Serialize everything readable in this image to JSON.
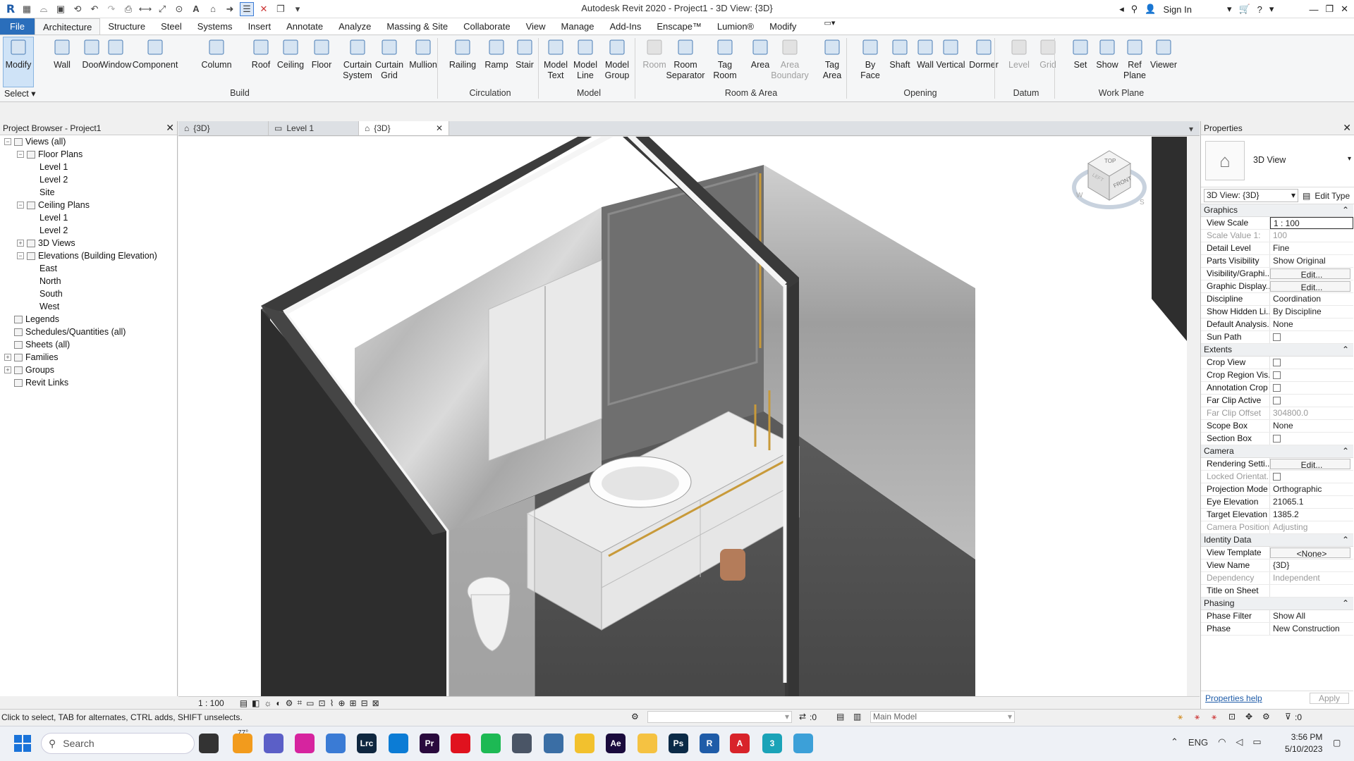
{
  "window": {
    "title": "Autodesk Revit 2020 - Project1 - 3D View: {3D}",
    "sign_in": "Sign In"
  },
  "ribbon_tabs": [
    "File",
    "Architecture",
    "Structure",
    "Steel",
    "Systems",
    "Insert",
    "Annotate",
    "Analyze",
    "Massing & Site",
    "Collaborate",
    "View",
    "Manage",
    "Add-Ins",
    "Enscape™",
    "Lumion®",
    "Modify"
  ],
  "active_tab": "Architecture",
  "ribbon": {
    "select_label": "Select",
    "buttons": [
      {
        "label": "Modify",
        "icon": "cursor-icon"
      },
      {
        "label": "Wall",
        "icon": "wall-icon"
      },
      {
        "label": "Door",
        "icon": "door-icon"
      },
      {
        "label": "Window",
        "icon": "window-icon"
      },
      {
        "label": "Component",
        "icon": "component-icon"
      },
      {
        "label": "Column",
        "icon": "column-icon"
      },
      {
        "label": "Roof",
        "icon": "roof-icon"
      },
      {
        "label": "Ceiling",
        "icon": "ceiling-icon"
      },
      {
        "label": "Floor",
        "icon": "floor-icon"
      },
      {
        "label": "Curtain\nSystem",
        "icon": "curtain-system-icon"
      },
      {
        "label": "Curtain\nGrid",
        "icon": "curtain-grid-icon"
      },
      {
        "label": "Mullion",
        "icon": "mullion-icon"
      },
      {
        "label": "Railing",
        "icon": "railing-icon"
      },
      {
        "label": "Ramp",
        "icon": "ramp-icon"
      },
      {
        "label": "Stair",
        "icon": "stair-icon"
      },
      {
        "label": "Model\nText",
        "icon": "model-text-icon"
      },
      {
        "label": "Model\nLine",
        "icon": "model-line-icon"
      },
      {
        "label": "Model\nGroup",
        "icon": "model-group-icon"
      },
      {
        "label": "Room",
        "icon": "room-icon"
      },
      {
        "label": "Room\nSeparator",
        "icon": "room-separator-icon"
      },
      {
        "label": "Tag\nRoom",
        "icon": "tag-room-icon"
      },
      {
        "label": "Area",
        "icon": "area-icon"
      },
      {
        "label": "Area\nBoundary",
        "icon": "area-boundary-icon"
      },
      {
        "label": "Tag\nArea",
        "icon": "tag-area-icon"
      },
      {
        "label": "By\nFace",
        "icon": "by-face-icon"
      },
      {
        "label": "Shaft",
        "icon": "shaft-icon"
      },
      {
        "label": "Wall",
        "icon": "wall-opening-icon"
      },
      {
        "label": "Vertical",
        "icon": "vertical-icon"
      },
      {
        "label": "Dormer",
        "icon": "dormer-icon"
      },
      {
        "label": "Level",
        "icon": "level-icon"
      },
      {
        "label": "Grid",
        "icon": "grid-icon"
      },
      {
        "label": "Set",
        "icon": "set-icon"
      },
      {
        "label": "Show",
        "icon": "show-icon"
      },
      {
        "label": "Ref\nPlane",
        "icon": "ref-plane-icon"
      },
      {
        "label": "Viewer",
        "icon": "viewer-icon"
      }
    ],
    "panels": [
      "Build",
      "Circulation",
      "Model",
      "Room & Area",
      "Opening",
      "Datum",
      "Work Plane"
    ]
  },
  "project_browser": {
    "title": "Project Browser - Project1",
    "tree": [
      {
        "label": "Views (all)",
        "depth": 0,
        "toggle": "−"
      },
      {
        "label": "Floor Plans",
        "depth": 1,
        "toggle": "−"
      },
      {
        "label": "Level 1",
        "depth": 2
      },
      {
        "label": "Level 2",
        "depth": 2
      },
      {
        "label": "Site",
        "depth": 2
      },
      {
        "label": "Ceiling Plans",
        "depth": 1,
        "toggle": "−"
      },
      {
        "label": "Level 1",
        "depth": 2
      },
      {
        "label": "Level 2",
        "depth": 2
      },
      {
        "label": "3D Views",
        "depth": 1,
        "toggle": "+"
      },
      {
        "label": "Elevations (Building Elevation)",
        "depth": 1,
        "toggle": "−"
      },
      {
        "label": "East",
        "depth": 2
      },
      {
        "label": "North",
        "depth": 2
      },
      {
        "label": "South",
        "depth": 2
      },
      {
        "label": "West",
        "depth": 2
      },
      {
        "label": "Legends",
        "depth": 0
      },
      {
        "label": "Schedules/Quantities (all)",
        "depth": 0
      },
      {
        "label": "Sheets (all)",
        "depth": 0
      },
      {
        "label": "Families",
        "depth": 0,
        "toggle": "+"
      },
      {
        "label": "Groups",
        "depth": 0,
        "toggle": "+"
      },
      {
        "label": "Revit Links",
        "depth": 0
      }
    ]
  },
  "view_tabs": [
    {
      "label": "{3D}",
      "active": false
    },
    {
      "label": "Level 1",
      "active": false
    },
    {
      "label": "{3D}",
      "active": true
    }
  ],
  "viewcube": {
    "top": "TOP",
    "front": "FRONT",
    "left": "LEFT",
    "west": "W",
    "south": "S"
  },
  "view_control_bar": {
    "scale": "1 : 100"
  },
  "properties": {
    "title": "Properties",
    "type_name": "3D View",
    "selector": "3D View: {3D}",
    "edit_type": "Edit Type",
    "sections": [
      {
        "name": "Graphics",
        "rows": [
          {
            "k": "View Scale",
            "v": "1 : 100",
            "kind": "input"
          },
          {
            "k": "Scale Value    1:",
            "v": "100",
            "ro": true
          },
          {
            "k": "Detail Level",
            "v": "Fine"
          },
          {
            "k": "Parts Visibility",
            "v": "Show Original"
          },
          {
            "k": "Visibility/Graphi...",
            "v": "Edit...",
            "kind": "button"
          },
          {
            "k": "Graphic Display...",
            "v": "Edit...",
            "kind": "button"
          },
          {
            "k": "Discipline",
            "v": "Coordination"
          },
          {
            "k": "Show Hidden Li...",
            "v": "By Discipline"
          },
          {
            "k": "Default Analysis...",
            "v": "None"
          },
          {
            "k": "Sun Path",
            "v": "",
            "kind": "checkbox"
          }
        ]
      },
      {
        "name": "Extents",
        "rows": [
          {
            "k": "Crop View",
            "v": "",
            "kind": "checkbox"
          },
          {
            "k": "Crop Region Vis...",
            "v": "",
            "kind": "checkbox"
          },
          {
            "k": "Annotation Crop",
            "v": "",
            "kind": "checkbox"
          },
          {
            "k": "Far Clip Active",
            "v": "",
            "kind": "checkbox"
          },
          {
            "k": "Far Clip Offset",
            "v": "304800.0",
            "ro": true
          },
          {
            "k": "Scope Box",
            "v": "None"
          },
          {
            "k": "Section Box",
            "v": "",
            "kind": "checkbox"
          }
        ]
      },
      {
        "name": "Camera",
        "rows": [
          {
            "k": "Rendering Setti...",
            "v": "Edit...",
            "kind": "button"
          },
          {
            "k": "Locked Orientat...",
            "v": "",
            "kind": "checkbox",
            "ro": true
          },
          {
            "k": "Projection Mode",
            "v": "Orthographic"
          },
          {
            "k": "Eye Elevation",
            "v": "21065.1"
          },
          {
            "k": "Target Elevation",
            "v": "1385.2"
          },
          {
            "k": "Camera Position",
            "v": "Adjusting",
            "ro": true
          }
        ]
      },
      {
        "name": "Identity Data",
        "rows": [
          {
            "k": "View Template",
            "v": "<None>",
            "kind": "button"
          },
          {
            "k": "View Name",
            "v": "{3D}"
          },
          {
            "k": "Dependency",
            "v": "Independent",
            "ro": true
          },
          {
            "k": "Title on Sheet",
            "v": ""
          }
        ]
      },
      {
        "name": "Phasing",
        "rows": [
          {
            "k": "Phase Filter",
            "v": "Show All"
          },
          {
            "k": "Phase",
            "v": "New Construction"
          }
        ]
      }
    ],
    "help_link": "Properties help",
    "apply": "Apply"
  },
  "status": {
    "message": "Click to select, TAB for alternates, CTRL adds, SHIFT unselects.",
    "count": ":0",
    "model": "Main Model",
    "filter_count": ":0"
  },
  "taskbar": {
    "search": "Search",
    "weather": "77°",
    "lang": "ENG",
    "time": "3:56 PM",
    "date": "5/10/2023",
    "apps": [
      {
        "name": "task-view-icon",
        "label": "",
        "color": "#333333"
      },
      {
        "name": "weather-icon",
        "label": "",
        "color": "#f29b1d"
      },
      {
        "name": "teams-icon",
        "label": "",
        "color": "#5b5fc7"
      },
      {
        "name": "instagram-icon",
        "label": "",
        "color": "#d6249f"
      },
      {
        "name": "sketch-icon",
        "label": "",
        "color": "#3a7bd5"
      },
      {
        "name": "lightroom-icon",
        "label": "Lrc",
        "color": "#0f2740"
      },
      {
        "name": "edge-icon",
        "label": "",
        "color": "#0c7cd5"
      },
      {
        "name": "premiere-icon",
        "label": "Pr",
        "color": "#2a0a3d"
      },
      {
        "name": "opera-icon",
        "label": "",
        "color": "#e0121e"
      },
      {
        "name": "spotify-icon",
        "label": "",
        "color": "#1db954"
      },
      {
        "name": "tool-icon",
        "label": "",
        "color": "#4a5566"
      },
      {
        "name": "revit-app-icon",
        "label": "",
        "color": "#3a6ea5"
      },
      {
        "name": "media-icon",
        "label": "",
        "color": "#f2c12e"
      },
      {
        "name": "after-effects-icon",
        "label": "Ae",
        "color": "#1a0b3d"
      },
      {
        "name": "folder-icon",
        "label": "",
        "color": "#f5c242"
      },
      {
        "name": "photoshop-icon",
        "label": "Ps",
        "color": "#0b2a47"
      },
      {
        "name": "revit-icon",
        "label": "R",
        "color": "#1f5ca8"
      },
      {
        "name": "autocad-icon",
        "label": "A",
        "color": "#d8232a"
      },
      {
        "name": "3dsmax-icon",
        "label": "3",
        "color": "#1aa3b8"
      },
      {
        "name": "globe-icon",
        "label": "",
        "color": "#3ca0d8"
      }
    ]
  },
  "colors": {
    "file_tab": "#2a6ebb",
    "accent": "#1f5ca8",
    "wall_dark": "#3c3c3c",
    "floor": "#555555",
    "gold": "#c89a3a"
  }
}
